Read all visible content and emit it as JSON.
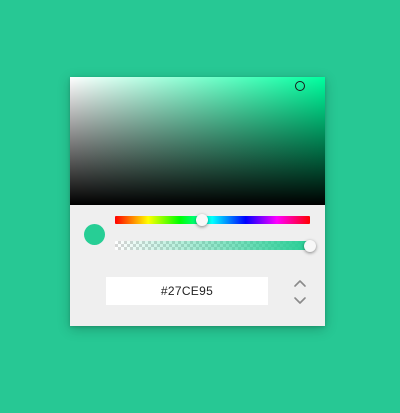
{
  "picker": {
    "hex_value": "#27CE95",
    "hue_deg": 160,
    "hue_fraction": 0.444,
    "saturation": 0.9,
    "brightness": 0.93,
    "alpha": 1.0,
    "colors": {
      "selected": "#27ce95",
      "hue_pure": "#00ff9f",
      "page_background": "#27c894",
      "panel_background": "#efefef"
    },
    "icons": {
      "increment": "chevron-up-icon",
      "decrement": "chevron-down-icon"
    }
  }
}
